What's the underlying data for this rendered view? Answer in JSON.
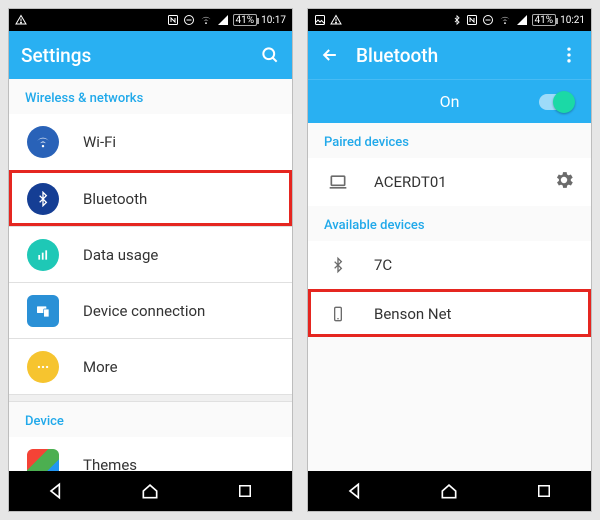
{
  "screens": {
    "left": {
      "statusbar": {
        "battery": "41%",
        "time": "10:17"
      },
      "appbar": {
        "title": "Settings"
      },
      "section1_title": "Wireless & networks",
      "rows": {
        "wifi": "Wi-Fi",
        "bluetooth": "Bluetooth",
        "data_usage": "Data usage",
        "device_connection": "Device connection",
        "more": "More"
      },
      "section2_title": "Device",
      "rows2": {
        "themes": "Themes"
      }
    },
    "right": {
      "statusbar": {
        "battery": "41%",
        "time": "10:21"
      },
      "appbar": {
        "title": "Bluetooth"
      },
      "subbar": {
        "state_label": "On"
      },
      "paired_title": "Paired devices",
      "paired": {
        "acerdt01": "ACERDT01"
      },
      "available_title": "Available devices",
      "available": {
        "sevenC": "7C",
        "benson": "Benson Net"
      }
    }
  }
}
